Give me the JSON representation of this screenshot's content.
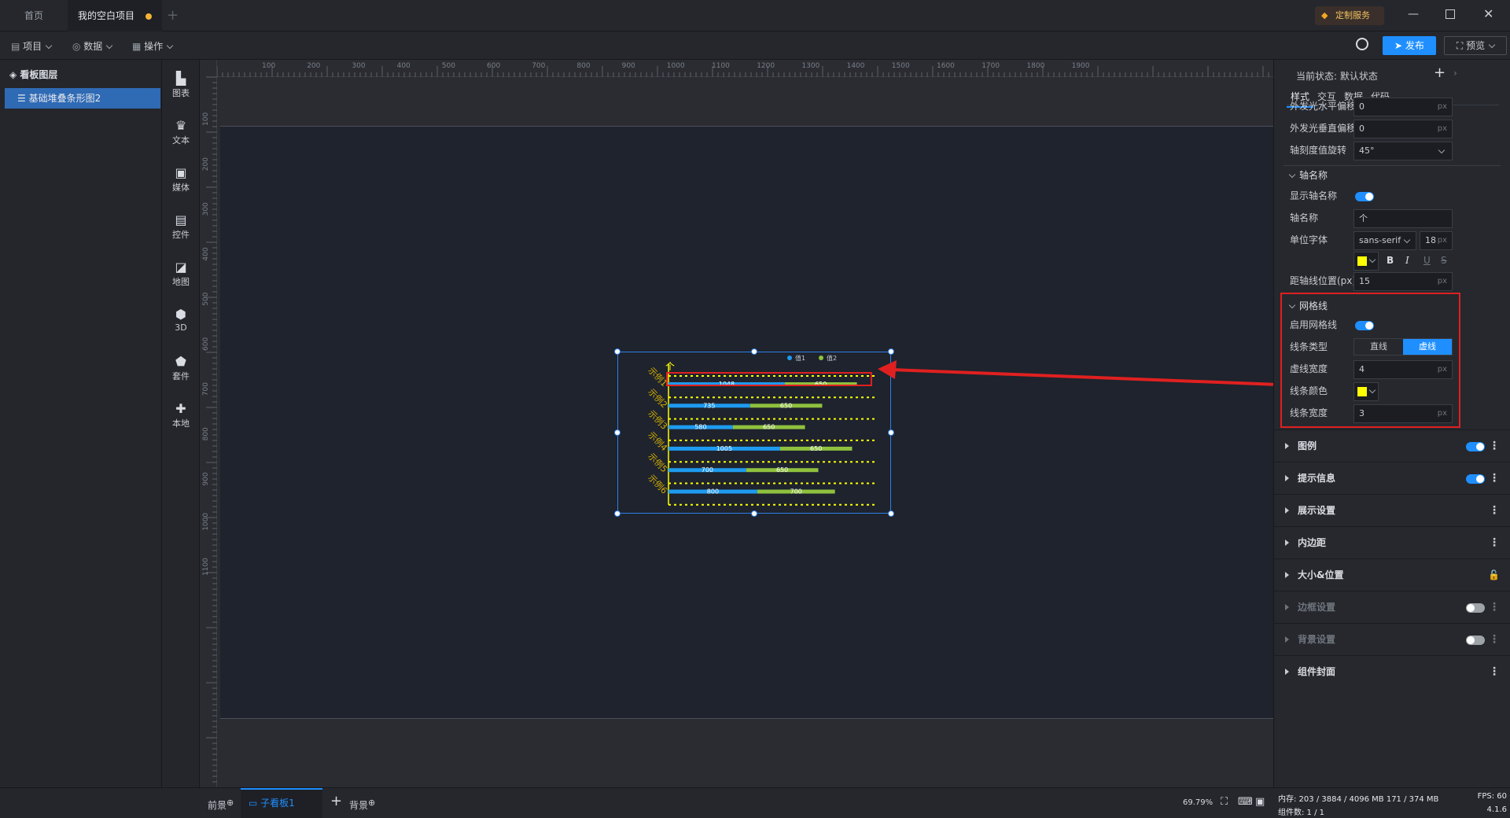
{
  "tabs": {
    "home": "首页",
    "project": "我的空白项目"
  },
  "custom_service": "定制服务",
  "toolbar": {
    "project": "项目",
    "data": "数据",
    "operate": "操作",
    "publish": "发布",
    "preview": "预览"
  },
  "layers": {
    "title": "看板图层",
    "item": "基础堆叠条形图2"
  },
  "components": [
    {
      "label": "图表",
      "glyph": "▙"
    },
    {
      "label": "文本",
      "glyph": "♛"
    },
    {
      "label": "媒体",
      "glyph": "▣"
    },
    {
      "label": "控件",
      "glyph": "▤"
    },
    {
      "label": "地图",
      "glyph": "◪"
    },
    {
      "label": "3D",
      "glyph": "⬢"
    },
    {
      "label": "套件",
      "glyph": "⬟"
    },
    {
      "label": "本地",
      "glyph": "✚"
    }
  ],
  "ruler": {
    "h": [
      "100",
      "200",
      "300",
      "400",
      "500",
      "600",
      "700",
      "800",
      "900",
      "1000",
      "1100",
      "1200",
      "1300",
      "1400",
      "1500",
      "1600",
      "1700",
      "1800",
      "1900"
    ],
    "v": [
      "100",
      "200",
      "300",
      "400",
      "500",
      "600",
      "700",
      "800",
      "900",
      "1000",
      "1100"
    ]
  },
  "chart_data": {
    "type": "bar",
    "orientation": "horizontal",
    "stacked": true,
    "categories": [
      "示例1",
      "示例2",
      "示例3",
      "示例4",
      "示例5",
      "示例6"
    ],
    "series": [
      {
        "name": "值1",
        "values": [
          1048,
          735,
          580,
          1005,
          700,
          800
        ],
        "color": "#1e9bf0"
      },
      {
        "name": "值2",
        "values": [
          650,
          650,
          650,
          650,
          650,
          700
        ],
        "color": "#8fc13e"
      }
    ],
    "axis_name": "个",
    "grid": {
      "line_type": "dashed",
      "color": "#ffff00"
    },
    "xlim": [
      0,
      1800
    ],
    "legend": "top-right"
  },
  "right": {
    "state_label": "当前状态:",
    "state_value": "默认状态",
    "tabs": [
      "样式",
      "交互",
      "数据",
      "代码"
    ],
    "glow_h_label": "外发光水平偏移",
    "glow_h_value": "0",
    "glow_h_unit": "px",
    "glow_v_label": "外发光垂直偏移",
    "glow_v_value": "0",
    "glow_v_unit": "px",
    "tick_rot_label": "轴刻度值旋转",
    "tick_rot_value": "45°",
    "axis_name_section": "轴名称",
    "show_axis_name_label": "显示轴名称",
    "axis_name_label": "轴名称",
    "axis_name_value": "个",
    "unit_font_label": "单位字体",
    "unit_font_family": "sans-serif",
    "unit_font_size": "18",
    "unit_font_unit": "px",
    "font_color": "#ffff00",
    "format_bold": "B",
    "format_italic": "I",
    "format_underline": "U",
    "format_strike": "S",
    "axis_dist_label": "距轴线位置(px)",
    "axis_dist_value": "15",
    "axis_dist_unit": "px",
    "grid_section": "网格线",
    "enable_grid_label": "启用网格线",
    "line_type_label": "线条类型",
    "line_type_solid": "直线",
    "line_type_dashed": "虚线",
    "dash_width_label": "虚线宽度",
    "dash_width_value": "4",
    "dash_width_unit": "px",
    "line_color_label": "线条颜色",
    "line_color": "#ffff00",
    "line_width_label": "线条宽度",
    "line_width_value": "3",
    "line_width_unit": "px",
    "sections": [
      {
        "label": "图例"
      },
      {
        "label": "提示信息"
      },
      {
        "label": "展示设置"
      },
      {
        "label": "内边距"
      },
      {
        "label": "大小&位置"
      },
      {
        "label": "边框设置"
      },
      {
        "label": "背景设置"
      },
      {
        "label": "组件封面"
      }
    ]
  },
  "bottom": {
    "foreground": "前景",
    "subboard": "子看板1",
    "background": "背景",
    "zoom": "69.79%"
  },
  "status": {
    "memory": "内存: 203 / 3884 / 4096 MB  171 / 374 MB",
    "fps": "FPS:  60",
    "count": "组件数: 1 / 1",
    "version": "4.1.6"
  },
  "colors": {
    "accent": "#1f8fff",
    "highlight": "#e02020",
    "selection": "#2f7fe6"
  }
}
